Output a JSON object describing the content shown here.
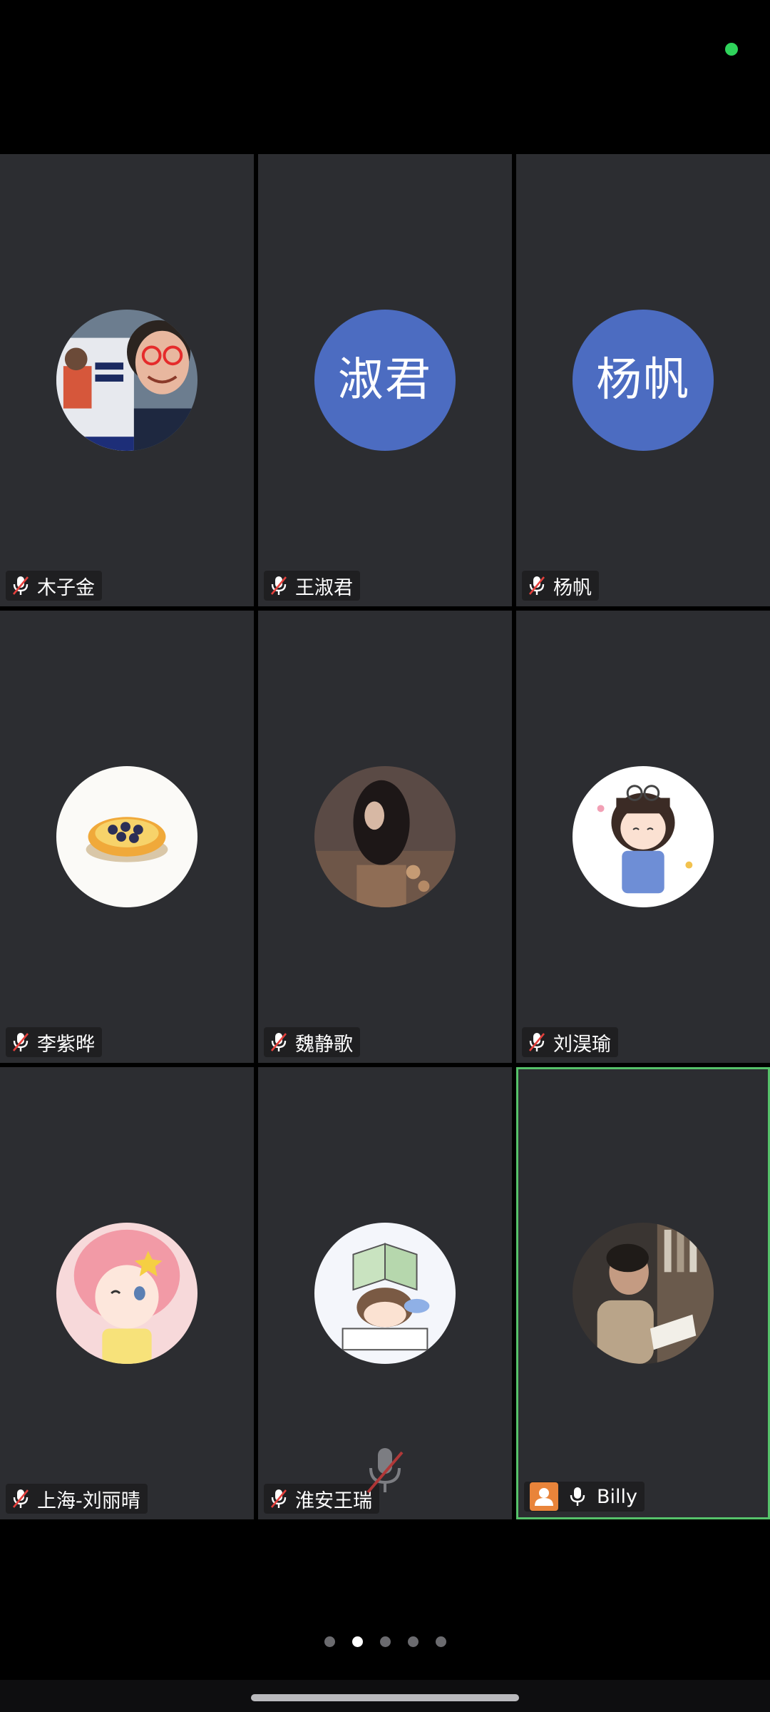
{
  "meeting": {
    "participants": [
      {
        "name": "木子金",
        "avatar_text": "",
        "avatar_kind": "photo-kid-with-book",
        "muted": true
      },
      {
        "name": "王淑君",
        "avatar_text": "淑君",
        "avatar_kind": "text",
        "muted": true
      },
      {
        "name": "杨帆",
        "avatar_text": "杨帆",
        "avatar_kind": "text",
        "muted": true
      },
      {
        "name": "李紫晔",
        "avatar_text": "",
        "avatar_kind": "egg-tart",
        "muted": true
      },
      {
        "name": "魏静歌",
        "avatar_text": "",
        "avatar_kind": "photo-dark-portrait",
        "muted": true
      },
      {
        "name": "刘淏瑜",
        "avatar_text": "",
        "avatar_kind": "cartoon-girl",
        "muted": true
      },
      {
        "name": "上海-刘丽晴",
        "avatar_text": "",
        "avatar_kind": "anime-pink-hair",
        "muted": true
      },
      {
        "name": "淮安王瑞",
        "avatar_text": "",
        "avatar_kind": "cartoon-studying",
        "muted": true
      },
      {
        "name": "Billy",
        "avatar_text": "",
        "avatar_kind": "photo-reading-man",
        "muted": false,
        "active_speaker": true
      }
    ],
    "pager": {
      "total": 5,
      "active_index": 1
    }
  },
  "colors": {
    "background": "#000000",
    "tile": "#2c2d31",
    "text_avatar": "#4c6cc1",
    "active_border": "#56c16a",
    "status_dot": "#2fd35b",
    "share_badge": "#e9843a"
  },
  "icons": {
    "muted_mic": "mic-muted-icon",
    "mic": "mic-icon",
    "share": "person-badge-icon",
    "status": "status-dot-icon"
  }
}
